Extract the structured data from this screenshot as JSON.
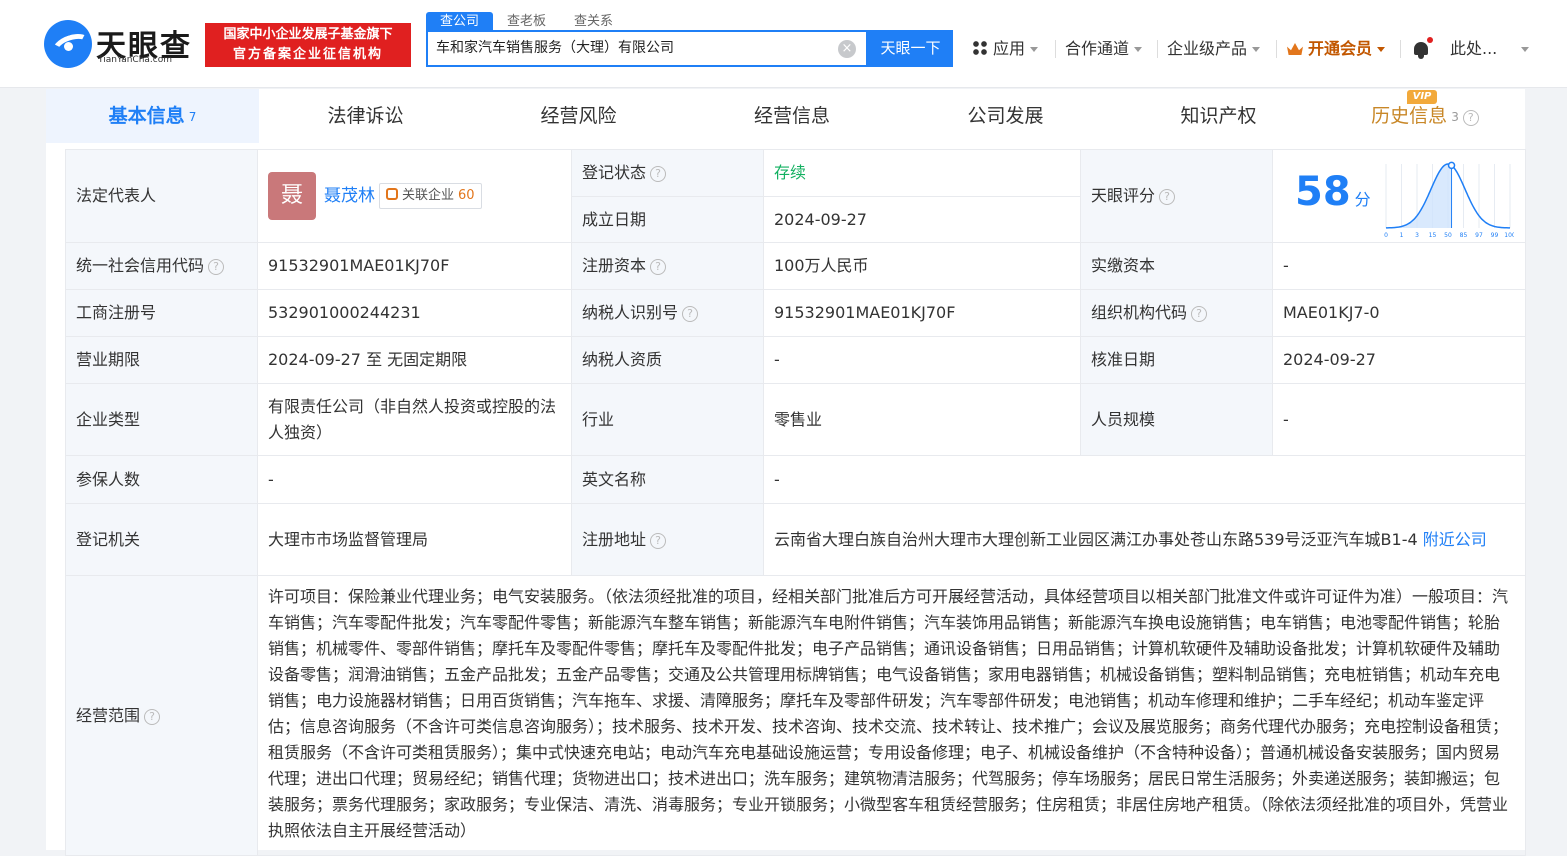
{
  "brand": {
    "name": "天眼查",
    "domain": "TianYanCha.com"
  },
  "badge": {
    "line1": "国家中小企业发展子基金旗下",
    "line2": "官方备案企业征信机构"
  },
  "search": {
    "tabs": [
      "查公司",
      "查老板",
      "查关系"
    ],
    "value": "车和家汽车销售服务（大理）有限公司",
    "button": "天眼一下",
    "clear_icon": "×"
  },
  "nav": {
    "apps": "应用",
    "channel": "合作通道",
    "enterprise": "企业级产品",
    "vip": "开通会员",
    "user": "此处..."
  },
  "tabs": [
    {
      "label": "基本信息",
      "count": "7"
    },
    {
      "label": "法律诉讼"
    },
    {
      "label": "经营风险"
    },
    {
      "label": "经营信息"
    },
    {
      "label": "公司发展"
    },
    {
      "label": "知识产权"
    },
    {
      "label": "历史信息",
      "count": "3",
      "tag": "VIP"
    }
  ],
  "info": {
    "legal_rep_label": "法定代表人",
    "legal_rep_avatar": "聂",
    "legal_rep_name": "聂茂林",
    "related_label": "关联企业",
    "related_count": "60",
    "reg_status_label": "登记状态",
    "reg_status": "存续",
    "found_date_label": "成立日期",
    "found_date": "2024-09-27",
    "score_label": "天眼评分",
    "score": "58",
    "score_unit": "分",
    "credit_code_label": "统一社会信用代码",
    "credit_code": "91532901MAE01KJ70F",
    "reg_capital_label": "注册资本",
    "reg_capital": "100万人民币",
    "paid_capital_label": "实缴资本",
    "paid_capital": "-",
    "biz_reg_no_label": "工商注册号",
    "biz_reg_no": "532901000244231",
    "taxpayer_id_label": "纳税人识别号",
    "taxpayer_id": "91532901MAE01KJ70F",
    "org_code_label": "组织机构代码",
    "org_code": "MAE01KJ7-0",
    "period_label": "营业期限",
    "period": "2024-09-27 至 无固定期限",
    "taxpayer_qual_label": "纳税人资质",
    "taxpayer_qual": "-",
    "approve_date_label": "核准日期",
    "approve_date": "2024-09-27",
    "type_label": "企业类型",
    "type": "有限责任公司（非自然人投资或控股的法人独资）",
    "industry_label": "行业",
    "industry": "零售业",
    "staff_label": "人员规模",
    "staff": "-",
    "insured_label": "参保人数",
    "insured": "-",
    "english_label": "英文名称",
    "english": "-",
    "authority_label": "登记机关",
    "authority": "大理市市场监督管理局",
    "address_label": "注册地址",
    "address": "云南省大理白族自治州大理市大理创新工业园区满江办事处苍山东路539号泛亚汽车城B1-4",
    "nearby": "附近公司",
    "scope_label": "经营范围",
    "scope": "许可项目：保险兼业代理业务；电气安装服务。（依法须经批准的项目，经相关部门批准后方可开展经营活动，具体经营项目以相关部门批准文件或许可证件为准）一般项目：汽车销售；汽车零配件批发；汽车零配件零售；新能源汽车整车销售；新能源汽车电附件销售；汽车装饰用品销售；新能源汽车换电设施销售；电车销售；电池零配件销售；轮胎销售；机械零件、零部件销售；摩托车及零配件零售；摩托车及零配件批发；电子产品销售；通讯设备销售；日用品销售；计算机软硬件及辅助设备批发；计算机软硬件及辅助设备零售；润滑油销售；五金产品批发；五金产品零售；交通及公共管理用标牌销售；电气设备销售；家用电器销售；机械设备销售；塑料制品销售；充电桩销售；机动车充电销售；电力设施器材销售；日用百货销售；汽车拖车、求援、清障服务；摩托车及零部件研发；汽车零部件研发；电池销售；机动车修理和维护；二手车经纪；机动车鉴定评估；信息咨询服务（不含许可类信息咨询服务）；技术服务、技术开发、技术咨询、技术交流、技术转让、技术推广；会议及展览服务；商务代理代办服务；充电控制设备租赁；租赁服务（不含许可类租赁服务）；集中式快速充电站；电动汽车充电基础设施运营；专用设备修理；电子、机械设备维护（不含特种设备）；普通机械设备安装服务；国内贸易代理；进出口代理；贸易经纪；销售代理；货物进出口；技术进出口；洗车服务；建筑物清洁服务；代驾服务；停车场服务；居民日常生活服务；外卖递送服务；装卸搬运；包装服务；票务代理服务；家政服务；专业保洁、清洗、消毒服务；专业开锁服务；小微型客车租赁经营服务；住房租赁；非居住房地产租赁。（除依法须经批准的项目外，凭营业执照依法自主开展经营活动）"
  },
  "score_chart": {
    "ticks": [
      "0",
      "1",
      "3",
      "15",
      "50",
      "85",
      "97",
      "99",
      "100"
    ],
    "value": 58
  },
  "colors": {
    "primary": "#1f7ff6",
    "brand_red": "#e02020",
    "status_green": "#12b060",
    "vip_orange": "#c25700"
  }
}
